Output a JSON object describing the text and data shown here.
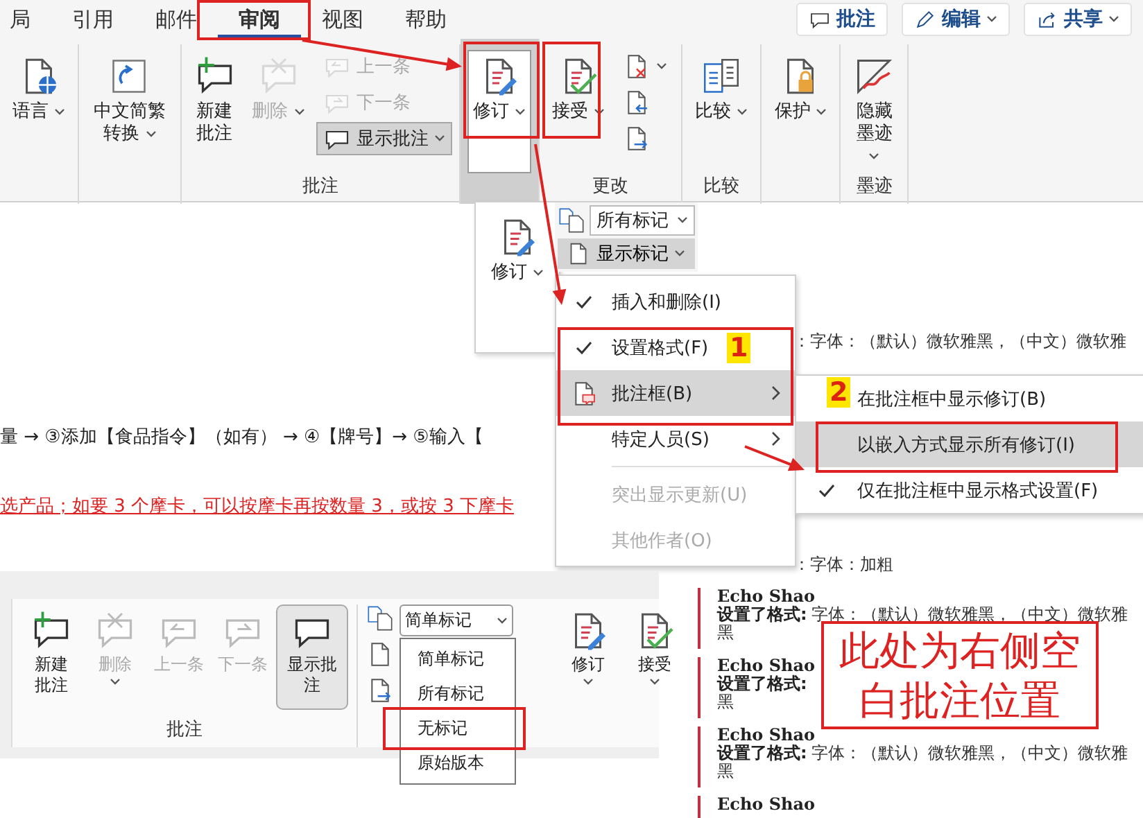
{
  "ribbon": {
    "tabs": [
      {
        "label": "局",
        "selected": false
      },
      {
        "label": "引用",
        "selected": false
      },
      {
        "label": "邮件",
        "selected": false
      },
      {
        "label": "审阅",
        "selected": true
      },
      {
        "label": "视图",
        "selected": false
      },
      {
        "label": "帮助",
        "selected": false
      }
    ],
    "actions": [
      {
        "label": "批注",
        "kind": "comment",
        "dropdown": false
      },
      {
        "label": "编辑",
        "kind": "edit",
        "dropdown": true
      },
      {
        "label": "共享",
        "kind": "share",
        "dropdown": true
      }
    ],
    "groups": [
      {
        "large": [
          {
            "label": "语言",
            "kind": "language",
            "disabled": false,
            "pressed": false,
            "dropdown": true
          }
        ]
      },
      {
        "large": [
          {
            "label": "中文简繁转换",
            "kind": "convert",
            "disabled": false,
            "pressed": false,
            "dropdown": true
          }
        ]
      },
      {
        "label": "批注",
        "large": [
          {
            "label": "新建批注",
            "kind": "new-comment",
            "disabled": false,
            "pressed": false,
            "dropdown": false
          },
          {
            "label": "删除",
            "kind": "delete",
            "disabled": true,
            "pressed": false,
            "dropdown": true
          }
        ],
        "small": [
          {
            "label": "上一条",
            "kind": "previous",
            "disabled": true,
            "pressed": false,
            "dropdown": false
          },
          {
            "label": "下一条",
            "kind": "next",
            "disabled": true,
            "pressed": false,
            "dropdown": false
          },
          {
            "label": "显示批注",
            "kind": "show-comments",
            "disabled": false,
            "pressed": true,
            "dropdown": true
          }
        ]
      },
      {
        "large": [
          {
            "label": "修订",
            "kind": "track",
            "disabled": false,
            "pressed": true,
            "dropdown": true
          }
        ]
      },
      {
        "label": "更改",
        "large": [
          {
            "label": "接受",
            "kind": "accept",
            "disabled": false,
            "pressed": false,
            "dropdown": true
          }
        ],
        "small": [
          {
            "kind": "reject",
            "disabled": false,
            "pressed": false,
            "dropdown": true
          },
          {
            "kind": "previous-change",
            "disabled": false,
            "pressed": false,
            "dropdown": false
          },
          {
            "kind": "next-change",
            "disabled": false,
            "pressed": false,
            "dropdown": false
          }
        ]
      },
      {
        "label": "比较",
        "large": [
          {
            "label": "比较",
            "kind": "compare",
            "disabled": false,
            "pressed": false,
            "dropdown": true
          }
        ]
      },
      {
        "large": [
          {
            "label": "保护",
            "kind": "protect",
            "disabled": false,
            "pressed": false,
            "dropdown": true
          }
        ]
      },
      {
        "label": "墨迹",
        "large": [
          {
            "label": "隐藏墨迹",
            "kind": "ink",
            "disabled": false,
            "pressed": false,
            "dropdown": true
          }
        ]
      }
    ]
  },
  "document": {
    "lines": [
      {
        "text": "量 → ③添加【食品指令】（如有） → ④【牌号】→ ⑤输入【",
        "kind": "normal"
      },
      {
        "text": "选产品；如要 3 个摩卡，可以按摩卡再按数量 3，或按 3 下摩卡",
        "kind": "revision"
      }
    ]
  },
  "track_menu": {
    "label": "修订"
  },
  "markup": {
    "value": "所有标记",
    "show_markup": "显示标记"
  },
  "show_markup_menu": [
    {
      "label": "插入和删除(I)",
      "kind": "plain",
      "checked": true,
      "disabled": false,
      "selected": false,
      "submenu": false
    },
    {
      "label": "设置格式(F)",
      "kind": "plain",
      "checked": true,
      "disabled": false,
      "selected": false,
      "submenu": false
    },
    {
      "label": "批注框(B)",
      "kind": "balloon",
      "checked": false,
      "disabled": false,
      "selected": true,
      "submenu": true
    },
    {
      "label": "特定人员(S)",
      "kind": "plain",
      "checked": false,
      "disabled": false,
      "selected": false,
      "submenu": true
    },
    {
      "label": "突出显示更新(U)",
      "kind": "plain",
      "checked": false,
      "disabled": true,
      "selected": false,
      "submenu": false
    },
    {
      "label": "其他作者(O)",
      "kind": "plain",
      "checked": false,
      "disabled": true,
      "selected": false,
      "submenu": false
    }
  ],
  "balloon_submenu": [
    {
      "label": "在批注框中显示修订(B)",
      "checked": false,
      "selected": false
    },
    {
      "label": "以嵌入方式显示所有修订(I)",
      "checked": false,
      "selected": true
    },
    {
      "label": "仅在批注框中显示格式设置(F)",
      "checked": true,
      "selected": false
    }
  ],
  "comments": {
    "snippets": [
      "：字体：（默认）微软雅黑，（中文）微软雅",
      "：字体：加粗"
    ],
    "entries": [
      {
        "author": "Echo Shao",
        "action": "设置了格式:",
        "detail": "字体：（默认）微软雅黑，（中文）微软雅",
        "overflow": "黑"
      },
      {
        "author": "Echo Shao",
        "action": "设置了格式:",
        "overflow": "黑"
      },
      {
        "author": "Echo Shao",
        "action": "设置了格式:",
        "detail": "字体：（默认）微软雅黑，（中文）微软雅",
        "overflow": "黑"
      },
      {
        "author": "Echo Shao"
      }
    ]
  },
  "annotations": {
    "badges": [
      "1",
      "2"
    ],
    "note": "此处为右侧空白批注位置"
  },
  "inset": {
    "group_label": "批注",
    "buttons": [
      {
        "label": "新建批注",
        "kind": "new-comment",
        "disabled": false,
        "pressed": false,
        "dropdown": false
      },
      {
        "label": "删除",
        "kind": "delete",
        "disabled": true,
        "pressed": false,
        "dropdown": true
      },
      {
        "label": "上一条",
        "kind": "previous",
        "disabled": true,
        "pressed": false,
        "dropdown": false
      },
      {
        "label": "下一条",
        "kind": "next",
        "disabled": true,
        "pressed": false,
        "dropdown": false
      },
      {
        "label": "显示批注",
        "kind": "show-comments",
        "disabled": false,
        "pressed": true,
        "dropdown": false
      }
    ],
    "markup_combo": {
      "value": "简单标记",
      "options": [
        "简单标记",
        "所有标记",
        "无标记",
        "原始版本"
      ]
    },
    "tracking": [
      {
        "label": "修订",
        "kind": "track",
        "disabled": false,
        "pressed": false,
        "dropdown": true
      },
      {
        "label": "接受",
        "kind": "accept",
        "disabled": false,
        "pressed": false,
        "dropdown": true
      }
    ]
  }
}
